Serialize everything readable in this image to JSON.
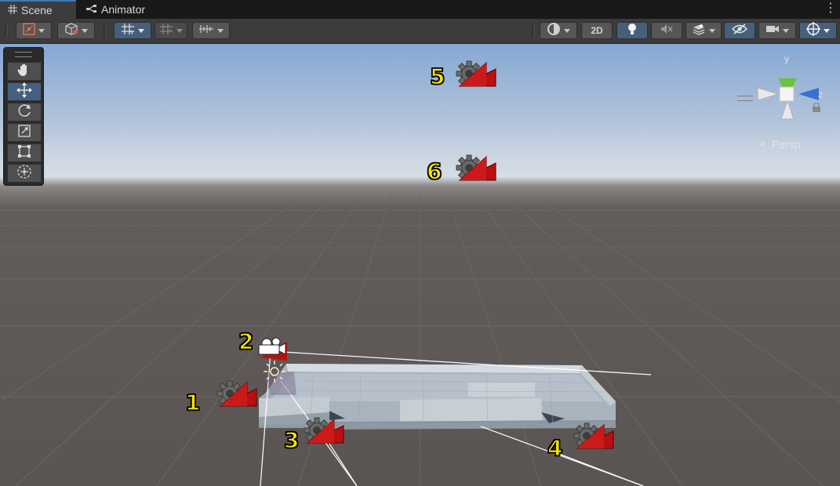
{
  "tabs": [
    {
      "label": "Scene",
      "icon": "grid-icon",
      "active": true
    },
    {
      "label": "Animator",
      "icon": "animator-icon",
      "active": false
    }
  ],
  "toolbar": {
    "left_buttons": [
      "tool-handle-position",
      "pivot-rotation",
      "grid-snapping",
      "increment-snapping",
      "snap-settings"
    ],
    "right_buttons": [
      "draw-mode",
      "2D",
      "lighting",
      "audio",
      "effects",
      "hidden-objects",
      "camera",
      "gizmos"
    ],
    "twod_label": "2D"
  },
  "tools": [
    "hand-tool",
    "move-tool",
    "rotate-tool",
    "scale-tool",
    "rect-tool",
    "transform-tool"
  ],
  "orientation_gizmo": {
    "y": "y",
    "z": "z",
    "projection": "Persp"
  },
  "markers": [
    {
      "label": "1",
      "kind": "camera-gizmo"
    },
    {
      "label": "2",
      "kind": "main-camera"
    },
    {
      "label": "3",
      "kind": "camera-gizmo"
    },
    {
      "label": "4",
      "kind": "camera-gizmo"
    },
    {
      "label": "5",
      "kind": "camera-gizmo"
    },
    {
      "label": "6",
      "kind": "camera-gizmo"
    }
  ],
  "colors": {
    "sky_top": "#8fb0d8",
    "horizon": "#c9d4e0",
    "ground": "#5e5856",
    "accent_blue": "#46607e",
    "marker_yellow": "#f6e400",
    "camera_red": "#b01010"
  }
}
